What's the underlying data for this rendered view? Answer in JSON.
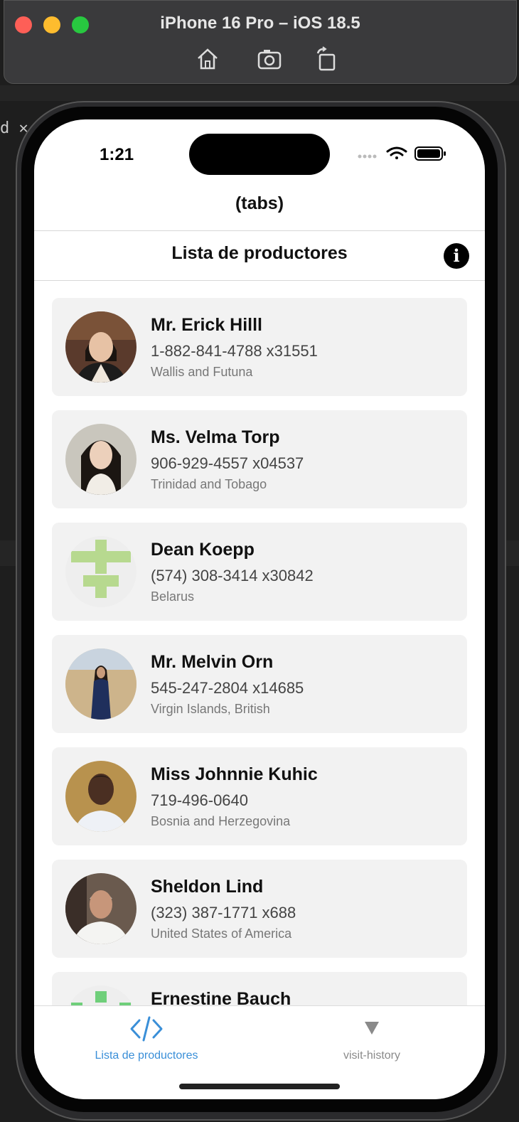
{
  "simulator": {
    "title": "iPhone 16 Pro – iOS 18.5",
    "tools": [
      "home-icon",
      "screenshot-icon",
      "rotate-icon"
    ]
  },
  "status_bar": {
    "time": "1:21"
  },
  "header": {
    "tabs_title": "(tabs)",
    "page_title": "Lista de productores",
    "info_label": "i"
  },
  "producers": [
    {
      "name": "Mr. Erick Hilll",
      "phone": "1-882-841-4788 x31551",
      "country": "Wallis and Futuna"
    },
    {
      "name": "Ms. Velma Torp",
      "phone": "906-929-4557 x04537",
      "country": "Trinidad and Tobago"
    },
    {
      "name": "Dean Koepp",
      "phone": "(574) 308-3414 x30842",
      "country": "Belarus"
    },
    {
      "name": "Mr. Melvin Orn",
      "phone": "545-247-2804 x14685",
      "country": "Virgin Islands, British"
    },
    {
      "name": "Miss Johnnie Kuhic",
      "phone": "719-496-0640",
      "country": "Bosnia and Herzegovina"
    },
    {
      "name": "Sheldon Lind",
      "phone": "(323) 387-1771 x688",
      "country": "United States of America"
    },
    {
      "name": "Ernestine Bauch",
      "phone": "",
      "country": ""
    }
  ],
  "tabbar": {
    "tabs": [
      {
        "label": "Lista de productores",
        "icon": "code-icon",
        "active": true
      },
      {
        "label": "visit-history",
        "icon": "triangle-down-icon",
        "active": false
      }
    ]
  },
  "colors": {
    "accent": "#3a8fd8",
    "inactive": "#8a8a8a",
    "card_bg": "#f2f2f2"
  }
}
